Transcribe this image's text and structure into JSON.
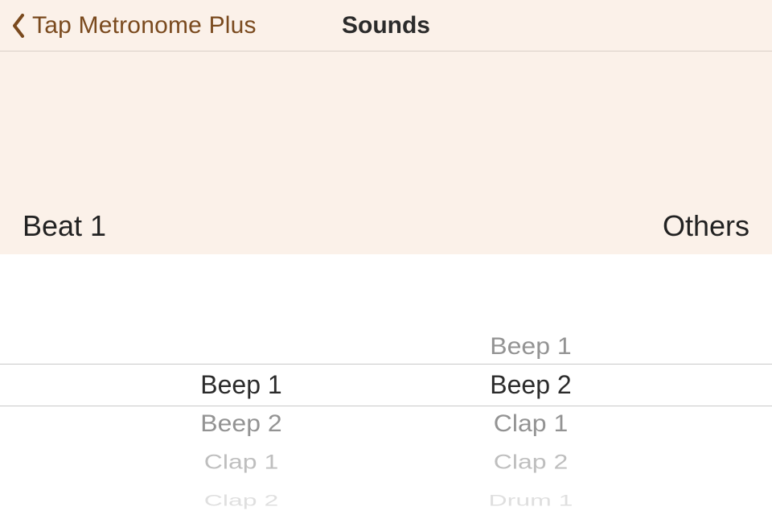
{
  "navbar": {
    "back_label": "Tap Metronome Plus",
    "title": "Sounds"
  },
  "subhead": {
    "left": "Beat 1",
    "right": "Others"
  },
  "pickers": {
    "beat1": {
      "selected_index": 0,
      "options": [
        "Beep 1",
        "Beep 2",
        "Clap 1",
        "Clap 2"
      ]
    },
    "others": {
      "selected_index": 1,
      "options": [
        "Beep 1",
        "Beep 2",
        "Clap 1",
        "Clap 2",
        "Drum 1"
      ]
    }
  },
  "colors": {
    "accent": "#7a4a1e",
    "header_bg": "#fbf1e9",
    "picker_bg": "#ffffff",
    "divider": "#c9c9c9"
  }
}
